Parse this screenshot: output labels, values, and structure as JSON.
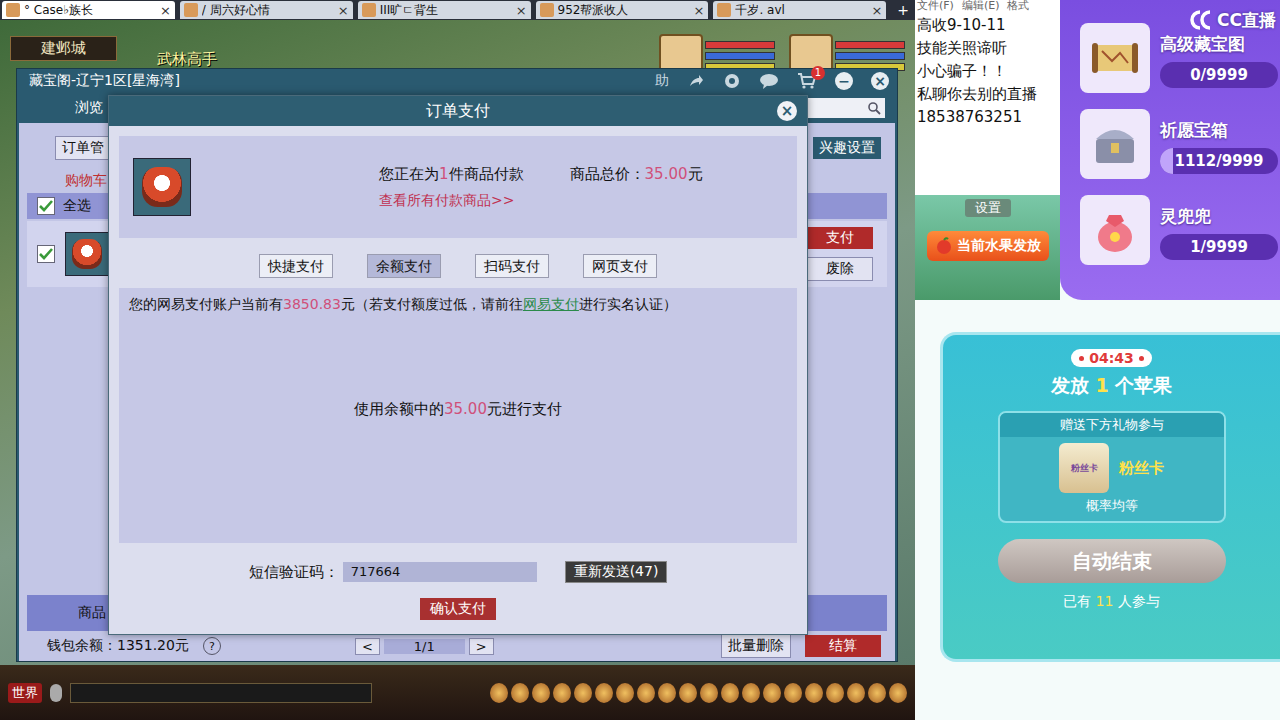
{
  "browser_tabs": [
    {
      "label": "° Case♭族长",
      "selected": true
    },
    {
      "label": "/ 周六好心情",
      "selected": false
    },
    {
      "label": "III旷ㄷ背生",
      "selected": false
    },
    {
      "label": "952帮派收人",
      "selected": false
    },
    {
      "label": "千岁. avl",
      "selected": false
    }
  ],
  "tab_close": "×",
  "new_tab": "+",
  "game": {
    "map_name": "建邺城",
    "npc_name": "武林高手",
    "chat_channel": "世界"
  },
  "cbg": {
    "title": "藏宝阁-辽宁1区[星海湾]",
    "help": "助",
    "cart_badge": "1",
    "minimize": "−",
    "close": "×",
    "nav_tab": "浏览",
    "order_button": "订单管",
    "interest_button": "兴趣设置",
    "cart_label": "购物车",
    "select_all": {
      "label": "全选",
      "checked": true
    },
    "items": [
      {
        "checked": true,
        "pay": "支付",
        "discard": "废除"
      }
    ],
    "table_header": "商品",
    "wallet": "钱包余额：1351.20元",
    "help_mark": "?",
    "pager": {
      "prev": "<",
      "page": "1/1",
      "next": ">"
    },
    "batch_delete": "批量删除",
    "checkout": "结算"
  },
  "modal": {
    "title": "订单支付",
    "close": "×",
    "summary_prefix": "您正在为",
    "summary_count": "1",
    "summary_suffix": "件商品付款",
    "total_label": "商品总价：",
    "total_value": "35.00",
    "total_unit": "元",
    "view_all": "查看所有付款商品>>",
    "methods": [
      {
        "label": "快捷支付",
        "selected": false
      },
      {
        "label": "余额支付",
        "selected": true
      },
      {
        "label": "扫码支付",
        "selected": false
      },
      {
        "label": "网页支付",
        "selected": false
      }
    ],
    "balance_prefix": "您的网易支付账户当前有",
    "balance_value": "3850.83",
    "balance_middle": "元（若支付额度过低，请前往",
    "balance_link": "网易支付",
    "balance_suffix": "进行实名认证）",
    "use_prefix": "使用余额中的",
    "use_value": "35.00",
    "use_suffix": "元进行支付",
    "sms_label": "短信验证码：",
    "sms_value": "717664",
    "resend": "重新发送(47)",
    "confirm": "确认支付"
  },
  "notepad": {
    "menu": [
      "文件(F)",
      "编辑(E)",
      "格式"
    ],
    "lines": [
      "高收9-10-11",
      "技能关照谛听",
      "小心骗子！！",
      "私聊你去别的直播",
      "18538763251"
    ]
  },
  "cc_logo": "CC直播",
  "tasks": [
    {
      "name": "高级藏宝图",
      "count": "0/9999",
      "level": 0
    },
    {
      "name": "祈愿宝箱",
      "count": "1112/9999",
      "level": 0.111
    },
    {
      "name": "灵兜兜",
      "count": "1/9999",
      "level": 0.0001
    }
  ],
  "settings": "设置",
  "fruit_banner": "当前水果发放",
  "lottery": {
    "timer": "04:43",
    "title_prefix": "发放",
    "title_count": "1",
    "title_suffix": "个苹果",
    "prompt": "赠送下方礼物参与",
    "gift_icon_text": "粉丝卡",
    "gift_name": "粉丝卡",
    "odds": "概率均等",
    "action": "自动结束",
    "joined_prefix": "已有",
    "joined_count": "11",
    "joined_suffix": "人参与"
  }
}
